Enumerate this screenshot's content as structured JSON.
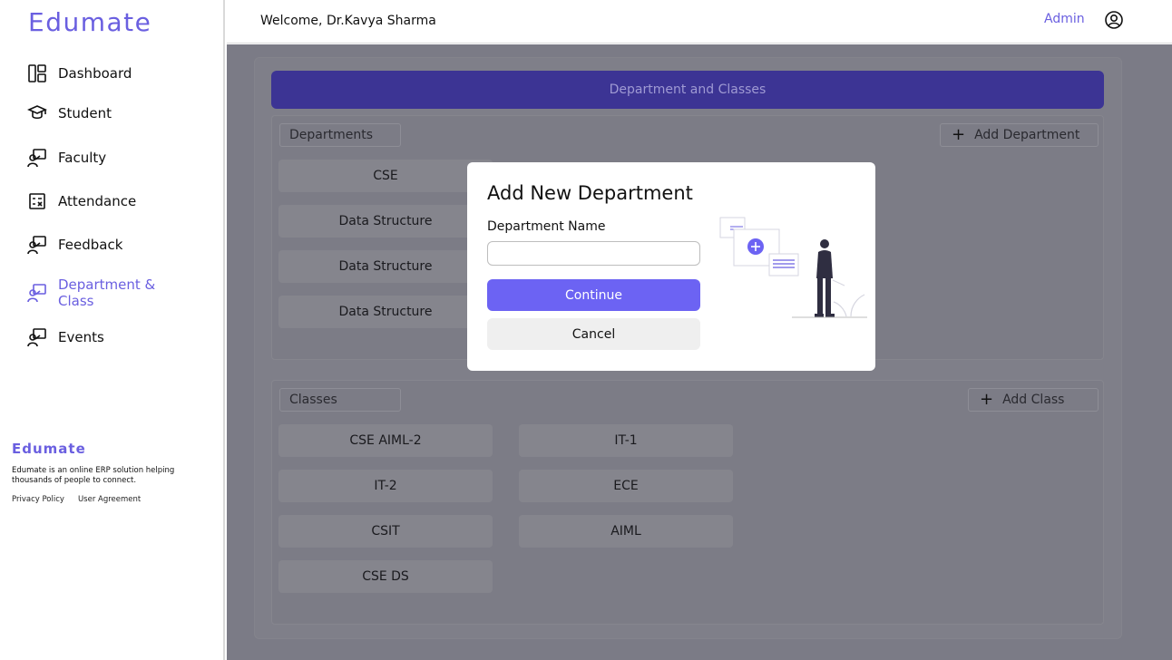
{
  "sidebar": {
    "brand": "Edumate",
    "items": [
      {
        "label": "Dashboard",
        "icon": "dashboard-icon"
      },
      {
        "label": "Student",
        "icon": "graduation-cap-icon"
      },
      {
        "label": "Faculty",
        "icon": "presenter-icon"
      },
      {
        "label": "Attendance",
        "icon": "attendance-icon"
      },
      {
        "label": "Feedback",
        "icon": "presenter-icon"
      },
      {
        "label": "Department & Class",
        "icon": "presenter-icon",
        "active": true
      },
      {
        "label": "Events",
        "icon": "presenter-icon"
      }
    ],
    "footer": {
      "brand": "Edumate",
      "description": "Edumate is an online ERP solution helping thousands of people to connect.",
      "links": [
        "Privacy Policy",
        "User Agreement"
      ]
    }
  },
  "header": {
    "welcome": "Welcome, Dr.Kavya Sharma",
    "role": "Admin",
    "user_icon": "user-circle-icon"
  },
  "page": {
    "title": "Department and Classes",
    "departments": {
      "label": "Departments",
      "add_label": "Add Department",
      "items": [
        "CSE",
        "Data Structure",
        "Data Structure",
        "Data Structure"
      ]
    },
    "classes": {
      "label": "Classes",
      "add_label": "Add Class",
      "items": [
        "CSE AIML-2",
        "IT-1",
        "IT-2",
        "ECE",
        "CSIT",
        "AIML",
        "CSE DS"
      ]
    }
  },
  "modal": {
    "title": "Add New Department",
    "field_label": "Department Name",
    "field_value": "",
    "field_placeholder": "",
    "continue_label": "Continue",
    "cancel_label": "Cancel"
  },
  "colors": {
    "accent": "#6a5fe0",
    "primary_button": "#6c63f3",
    "header_bar": "#3c3494"
  }
}
